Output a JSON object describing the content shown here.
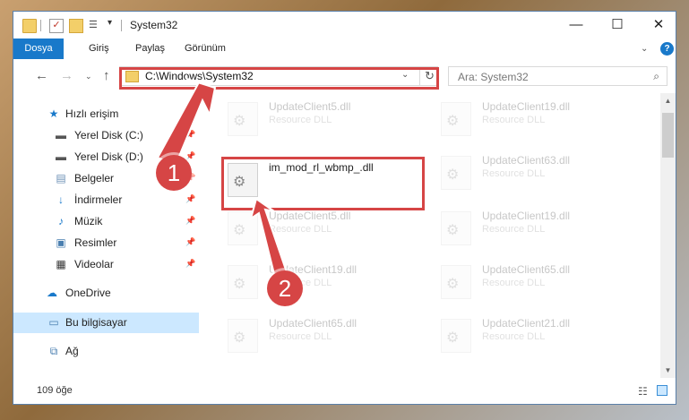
{
  "window": {
    "title": "System32"
  },
  "titlebar": {
    "minimize": "—",
    "maximize": "☐",
    "close": "✕"
  },
  "ribbon": {
    "tabs": [
      "Dosya",
      "Giriş",
      "Paylaş",
      "Görünüm"
    ],
    "expand": "⌄",
    "help": "?"
  },
  "address": {
    "path": "C:\\Windows\\System32",
    "refresh": "↻"
  },
  "search": {
    "placeholder": "Ara: System32"
  },
  "nav": {
    "back": "←",
    "forward": "→",
    "history": "⌄",
    "up": "↑"
  },
  "sidebar": {
    "items": [
      {
        "label": "Hızlı erişim",
        "icon": "star-icon",
        "pinned": false
      },
      {
        "label": "Yerel Disk (C:)",
        "icon": "drive-icon",
        "pinned": true
      },
      {
        "label": "Yerel Disk (D:)",
        "icon": "drive-icon",
        "pinned": true
      },
      {
        "label": "Belgeler",
        "icon": "documents-icon",
        "pinned": true
      },
      {
        "label": "İndirmeler",
        "icon": "download-icon",
        "pinned": true
      },
      {
        "label": "Müzik",
        "icon": "music-icon",
        "pinned": true
      },
      {
        "label": "Resimler",
        "icon": "pictures-icon",
        "pinned": true
      },
      {
        "label": "Videolar",
        "icon": "videos-icon",
        "pinned": true
      },
      {
        "label": "OneDrive",
        "icon": "cloud-icon",
        "pinned": false
      },
      {
        "label": "Bu bilgisayar",
        "icon": "computer-icon",
        "pinned": false
      },
      {
        "label": "Ağ",
        "icon": "network-icon",
        "pinned": false
      }
    ]
  },
  "files": {
    "target": {
      "name": "im_mod_rl_wbmp_.dll"
    },
    "background": [
      {
        "name": "UpdateClient5.dll",
        "desc": "Resource DLL"
      },
      {
        "name": "UpdateClient19.dll",
        "desc": "Resource DLL"
      },
      {
        "name": "UpdateClient63.dll",
        "desc": "Resource DLL"
      },
      {
        "name": "UpdateClient5.dll",
        "desc": "Resource DLL"
      },
      {
        "name": "UpdateClient19.dll",
        "desc": "Resource DLL"
      },
      {
        "name": "UpdateClient19.dll",
        "desc": "Resource DLL"
      },
      {
        "name": "UpdateClient65.dll",
        "desc": "Resource DLL"
      },
      {
        "name": "UpdateClient65.dll",
        "desc": "Resource DLL"
      },
      {
        "name": "UpdateClient21.dll",
        "desc": "Resource DLL"
      }
    ]
  },
  "status": {
    "count": "109 öğe"
  },
  "annotations": {
    "step1": "1",
    "step2": "2"
  },
  "colors": {
    "accent": "#1979ca",
    "highlight": "#d64545",
    "selected": "#cce8ff"
  }
}
